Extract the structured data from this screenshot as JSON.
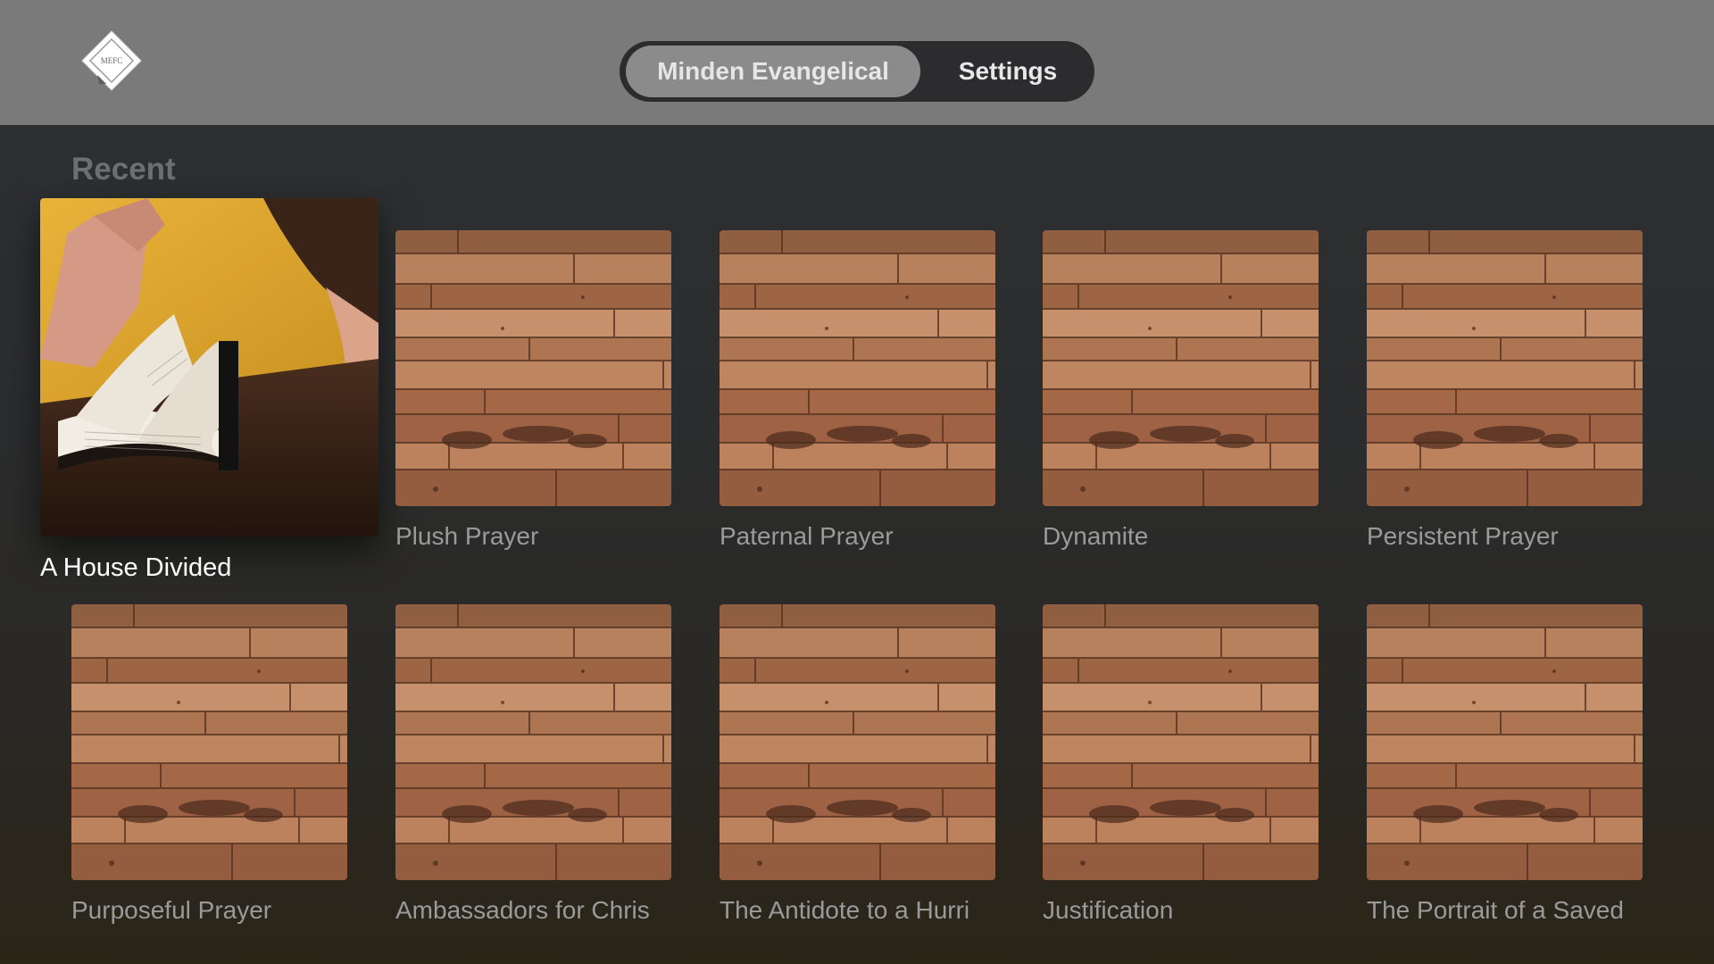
{
  "header": {
    "logo_text": "MEFC",
    "tabs": [
      {
        "label": "Minden Evangelical",
        "selected": true
      },
      {
        "label": "Settings",
        "selected": false
      }
    ]
  },
  "section": {
    "title": "Recent",
    "items": [
      {
        "title": "A House Divided",
        "artwork": "bible-reading-photo",
        "focused": true
      },
      {
        "title": "Plush Prayer",
        "artwork": "wood-planks"
      },
      {
        "title": "Paternal Prayer",
        "artwork": "wood-planks"
      },
      {
        "title": "Dynamite",
        "artwork": "wood-planks"
      },
      {
        "title": "Persistent Prayer",
        "artwork": "wood-planks"
      },
      {
        "title": "Purposeful Prayer",
        "artwork": "wood-planks"
      },
      {
        "title": "Ambassadors for Chris",
        "artwork": "wood-planks"
      },
      {
        "title": "The Antidote to a Hurri",
        "artwork": "wood-planks"
      },
      {
        "title": "Justification",
        "artwork": "wood-planks"
      },
      {
        "title": "The Portrait of a Saved",
        "artwork": "wood-planks"
      }
    ]
  },
  "colors": {
    "header_bg": "#7a7a7a",
    "tab_selected_bg": "#8b8b8b",
    "tabbar_bg": "#2c2c2e"
  }
}
